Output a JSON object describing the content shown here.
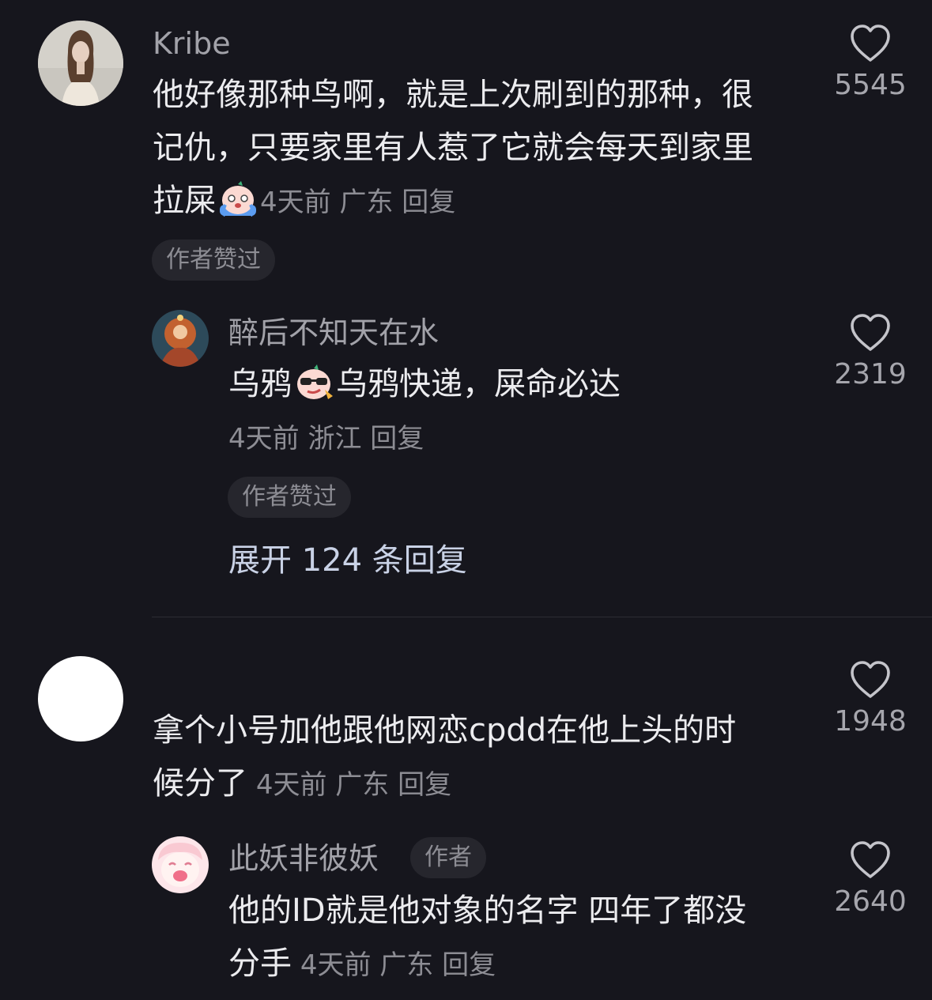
{
  "comments": [
    {
      "username": "Kribe",
      "text_lines": [
        "他好像那种鸟啊，就是上次刷到的那种，很",
        "记仇，只要家里有人惹了它就会每天到家里",
        "拉屎"
      ],
      "emoji": "crying-face-emoji",
      "time": "4天前",
      "location": "广东",
      "reply_label": "回复",
      "likes": "5545",
      "badge": "作者赞过",
      "replies": [
        {
          "username": "醉后不知天在水",
          "text_before_emoji": "乌鸦",
          "emoji": "cool-sunglasses-emoji",
          "text_after_emoji": "乌鸦快递，屎命必达",
          "time": "4天前",
          "location": "浙江",
          "reply_label": "回复",
          "likes": "2319",
          "badge": "作者赞过"
        }
      ],
      "expand_label": "展开 124 条回复"
    },
    {
      "username": "",
      "text_lines": [
        "拿个小号加他跟他网恋cpdd在他上头的时",
        "候分了"
      ],
      "time": "4天前",
      "location": "广东",
      "reply_label": "回复",
      "likes": "1948",
      "replies": [
        {
          "username": "此妖非彼妖",
          "author_tag": "作者",
          "text_lines": [
            "他的ID就是他对象的名字 四年了都没",
            "分手"
          ],
          "time": "4天前",
          "location": "广东",
          "reply_label": "回复",
          "likes": "2640"
        }
      ]
    }
  ],
  "colors": {
    "background": "#16161d",
    "text_primary": "#ececef",
    "text_secondary": "#8d8d94",
    "expand_link": "#c9d2e6",
    "pill_background": "#26262d"
  },
  "icons": {
    "like": "heart-outline-icon"
  }
}
